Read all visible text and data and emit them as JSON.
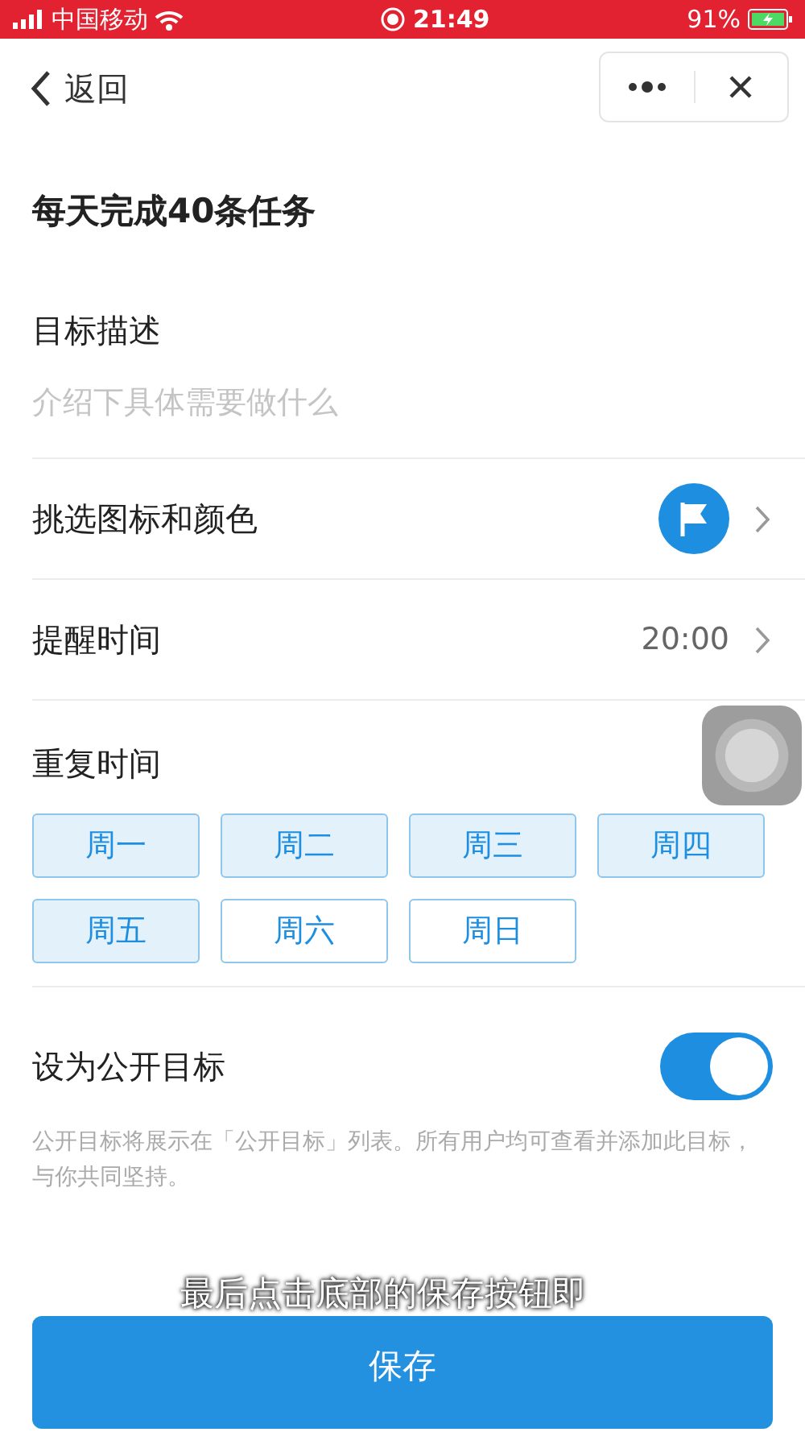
{
  "status_bar": {
    "carrier": "中国移动",
    "time": "21:49",
    "battery": "91%"
  },
  "nav": {
    "back": "返回"
  },
  "title": "每天完成40条任务",
  "description": {
    "label": "目标描述",
    "placeholder": "介绍下具体需要做什么"
  },
  "rows": [
    {
      "kind": "icon",
      "label": "挑选图标和颜色",
      "color": "#1e8ee0"
    },
    {
      "kind": "time",
      "label": "提醒时间",
      "value": "20:00"
    }
  ],
  "repeat": {
    "label": "重复时间",
    "days": [
      {
        "label": "周一",
        "selected": true
      },
      {
        "label": "周二",
        "selected": true
      },
      {
        "label": "周三",
        "selected": true
      },
      {
        "label": "周四",
        "selected": true
      },
      {
        "label": "周五",
        "selected": true
      },
      {
        "label": "周六",
        "selected": false
      },
      {
        "label": "周日",
        "selected": false
      }
    ]
  },
  "public": {
    "label": "设为公开目标",
    "on": true,
    "note": "公开目标将展示在「公开目标」列表。所有用户均可查看并添加此目标，与你共同坚持。"
  },
  "save_button": "保存",
  "caption": "最后点击底部的保存按钮即"
}
